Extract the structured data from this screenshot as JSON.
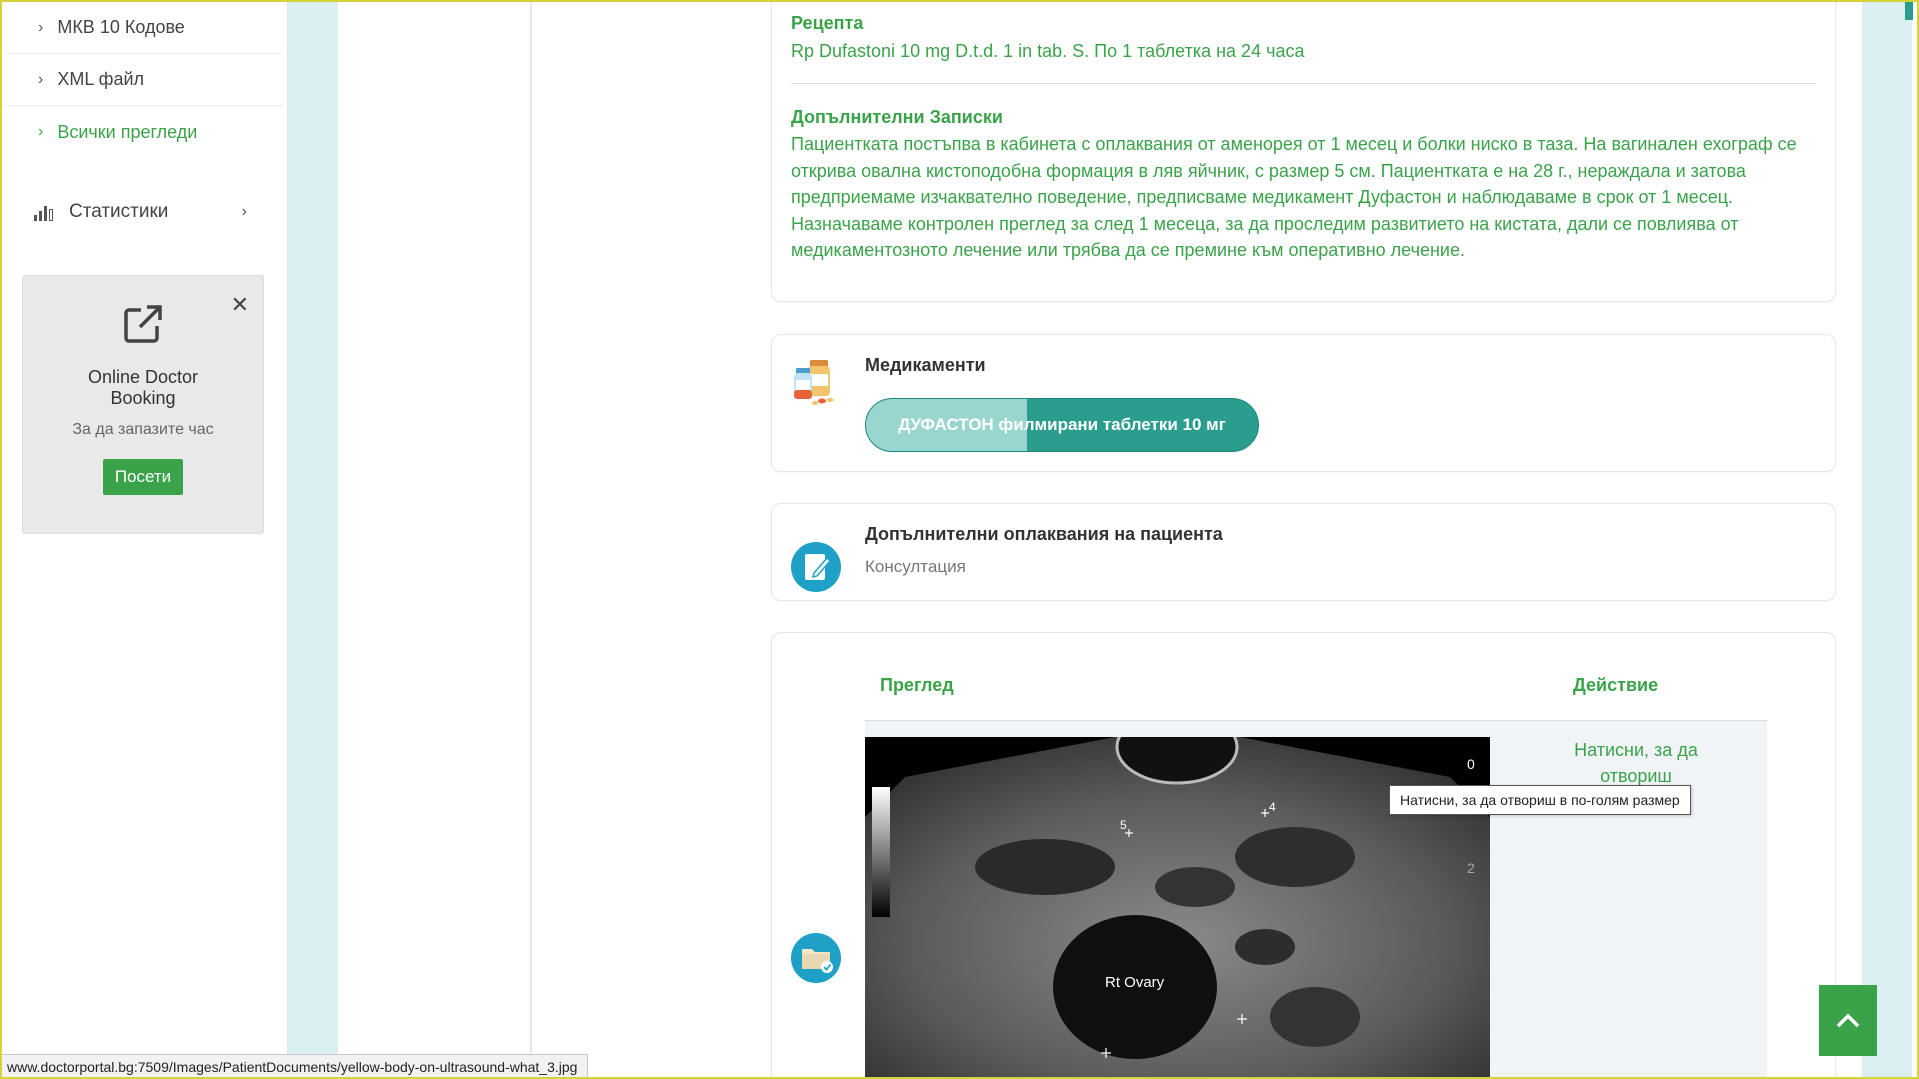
{
  "sidebar": {
    "items": [
      {
        "label": "МКВ 10 Кодове"
      },
      {
        "label": "XML файл"
      },
      {
        "label": "Всички прегледи"
      }
    ],
    "stats_label": "Статистики",
    "promo": {
      "title": "Online Doctor Booking",
      "subtitle": "За да запазите час",
      "button": "Посети",
      "close": "✕"
    }
  },
  "prescription": {
    "heading": "Рецепта",
    "text": "Rp Dufastoni 10 mg D.t.d. 1 in tab. S. По 1 таблетка на 24 часа"
  },
  "notes": {
    "heading": "Допълнителни Записки",
    "text": "Пациентката постъпва в кабинета с оплаквания от аменорея от 1 месец и болки ниско в таза. На вагинален ехограф се открива овална кистоподобна формация в ляв яйчник, с размер 5 см. Пациентката е на 28 г., нераждала и затова предприемаме изчаквателно поведение, предписваме медикамент Дуфастон и наблюдаваме в срок от 1 месец. Назначаваме контролен преглед за след 1 месеца, за да проследим развитието на кистата, дали се повлиява от медикаментозното лечение или трябва да се премине към оперативно лечение."
  },
  "medications": {
    "heading": "Медикаменти",
    "pill_label": "ДУФАСТОН филмирани таблетки 10 мг",
    "pill_progress": 0.41
  },
  "complaints": {
    "heading": "Допълнителни оплаквания на пациента",
    "value": "Консултация"
  },
  "exams_table": {
    "columns": [
      "Преглед",
      "Действие"
    ],
    "row": {
      "image_labels": {
        "organ": "Rt Ovary",
        "marker1": "5",
        "marker2": "4",
        "depth0": "0",
        "depth2": "2"
      },
      "action_text": "Натисни, за да отвориш"
    }
  },
  "tooltip": "Натисни, за да отвориш в по-голям размер",
  "status_url": "www.doctorportal.bg:7509/Images/PatientDocuments/yellow-body-on-ultrasound-what_3.jpg",
  "colors": {
    "accent_green": "#3aa34a",
    "teal": "#2a9d8f",
    "teal_light": "#9ad6d0",
    "strip": "#dceff0"
  },
  "icons": {
    "sidebar_chevron": "chevron-right-icon",
    "stats": "bar-chart-icon",
    "promo": "external-link-icon",
    "medication": "pill-bottles-icon",
    "complaints": "edit-note-icon",
    "exams": "folder-check-icon",
    "scroll_top": "chevron-up-icon"
  }
}
